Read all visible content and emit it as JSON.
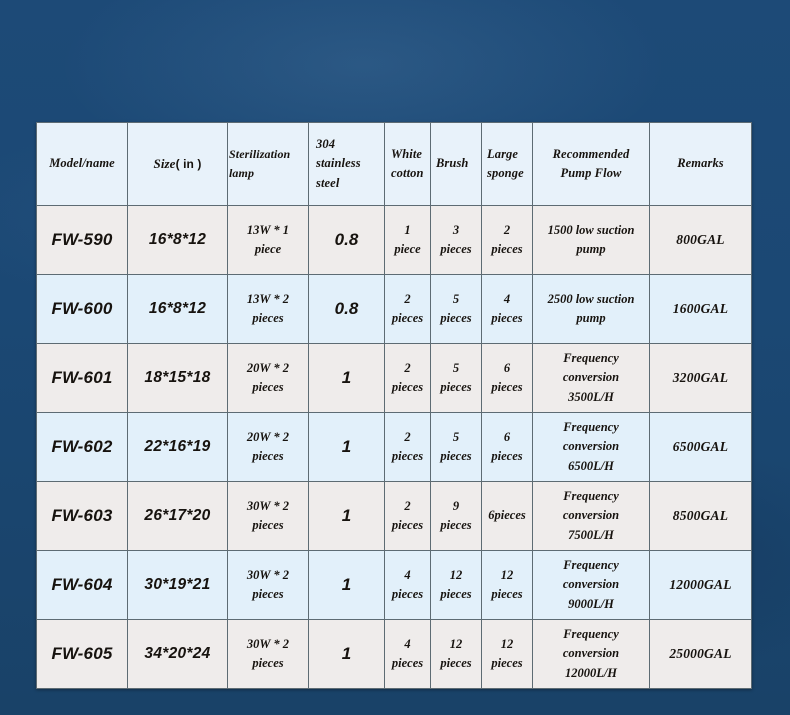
{
  "background": {
    "color": "#1b4874"
  },
  "table": {
    "border_color": "#5d6b73",
    "header_bg": "#e8f2fa",
    "row_odd_bg": "#efeceb",
    "row_even_bg": "#e2f0fa",
    "columns": [
      {
        "key": "model",
        "label": "Model/name",
        "label_l2": ""
      },
      {
        "key": "size",
        "label": "Size",
        "label_unit": "( in )",
        "label_l2": ""
      },
      {
        "key": "steril",
        "label": "Sterilization lamp",
        "label_l2": ""
      },
      {
        "key": "steel",
        "label": "304 stainless",
        "label_l2": "steel"
      },
      {
        "key": "cotton",
        "label": "White",
        "label_l2": "cotton"
      },
      {
        "key": "brush",
        "label": "Brush",
        "label_l2": ""
      },
      {
        "key": "sponge",
        "label": "Large",
        "label_l2": "sponge"
      },
      {
        "key": "pump",
        "label": "Recommended",
        "label_l2": "Pump Flow"
      },
      {
        "key": "remarks",
        "label": "Remarks",
        "label_l2": ""
      }
    ],
    "rows": [
      {
        "model": "FW-590",
        "size": "16*8*12",
        "steril": "13W * 1 piece",
        "steel": "0.8",
        "cotton": "1 piece",
        "brush": "3 pieces",
        "sponge": "2 pieces",
        "pump_l1": "1500 low suction",
        "pump_l2": "pump",
        "remarks": "800GAL"
      },
      {
        "model": "FW-600",
        "size": "16*8*12",
        "steril": "13W * 2 pieces",
        "steel": "0.8",
        "cotton": "2 pieces",
        "brush": "5 pieces",
        "sponge": "4 pieces",
        "pump_l1": "2500 low suction",
        "pump_l2": "pump",
        "remarks": "1600GAL"
      },
      {
        "model": "FW-601",
        "size": "18*15*18",
        "steril": "20W * 2 pieces",
        "steel": "1",
        "cotton": "2 pieces",
        "brush": "5 pieces",
        "sponge": "6 pieces",
        "pump_l1": "Frequency conversion",
        "pump_l2": "3500L/H",
        "remarks": "3200GAL"
      },
      {
        "model": "FW-602",
        "size": "22*16*19",
        "steril": "20W * 2 pieces",
        "steel": "1",
        "cotton": "2 pieces",
        "brush": "5 pieces",
        "sponge": "6 pieces",
        "pump_l1": "Frequency conversion",
        "pump_l2": "6500L/H",
        "remarks": "6500GAL"
      },
      {
        "model": "FW-603",
        "size": "26*17*20",
        "steril": "30W * 2 pieces",
        "steel": "1",
        "cotton": "2 pieces",
        "brush": "9 pieces",
        "sponge": "6pieces",
        "pump_l1": "Frequency conversion",
        "pump_l2": "7500L/H",
        "remarks": "8500GAL"
      },
      {
        "model": "FW-604",
        "size": "30*19*21",
        "steril": "30W * 2 pieces",
        "steel": "1",
        "cotton": "4 pieces",
        "brush": "12 pieces",
        "sponge": "12 pieces",
        "pump_l1": "Frequency conversion",
        "pump_l2": "9000L/H",
        "remarks": "12000GAL"
      },
      {
        "model": "FW-605",
        "size": "34*20*24",
        "steril": "30W * 2 pieces",
        "steel": "1",
        "cotton": "4 pieces",
        "brush": "12 pieces",
        "sponge": "12 pieces",
        "pump_l1": "Frequency conversion",
        "pump_l2": "12000L/H",
        "remarks": "25000GAL"
      }
    ]
  }
}
